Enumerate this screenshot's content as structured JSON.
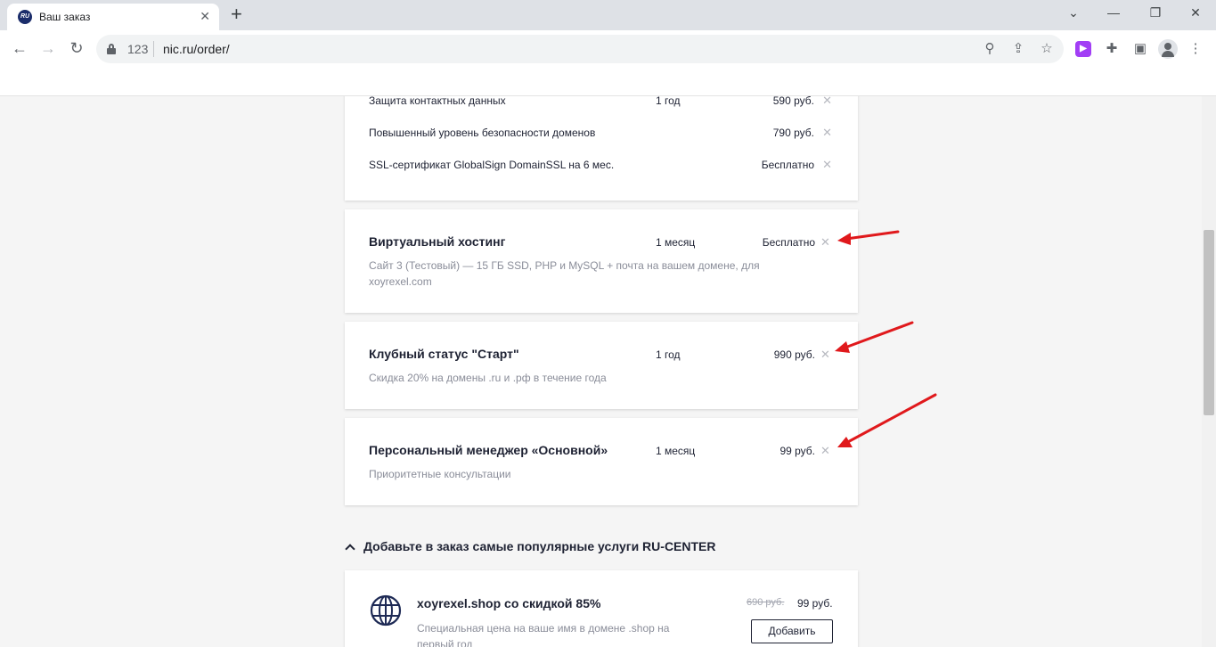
{
  "browser": {
    "tab_title": "Ваш заказ",
    "tab_favicon_text": "RU",
    "url_prefix": "123",
    "url": "nic.ru/order/"
  },
  "services": [
    {
      "name": "Защита контактных данных",
      "period": "1 год",
      "price": "590 руб."
    },
    {
      "name": "Повышенный уровень безопасности доменов",
      "period": "",
      "price": "790 руб."
    },
    {
      "name": "SSL-сертификат GlobalSign DomainSSL на 6 мес.",
      "period": "",
      "price": "Бесплатно"
    }
  ],
  "order_items": [
    {
      "title": "Виртуальный хостинг",
      "period": "1 месяц",
      "price": "Бесплатно",
      "description": "Сайт 3 (Тестовый) — 15 ГБ SSD, PHP и MySQL + почта на вашем домене, для xoyrexel.com"
    },
    {
      "title": "Клубный статус \"Старт\"",
      "period": "1 год",
      "price": "990 руб.",
      "description": "Скидка 20% на домены .ru и .рф в течение года"
    },
    {
      "title": "Персональный менеджер «Основной»",
      "period": "1 месяц",
      "price": "99 руб.",
      "description": "Приоритетные консультации"
    }
  ],
  "popular": {
    "heading": "Добавьте в заказ самые популярные услуги RU-CENTER",
    "promo": {
      "title": "xoyrexel.shop со скидкой 85%",
      "description": "Специальная цена на ваше имя в домене .shop на первый год",
      "old_price": "690 руб.",
      "new_price": "99 руб.",
      "add_label": "Добавить"
    }
  },
  "annotation_color": "#e0191c"
}
